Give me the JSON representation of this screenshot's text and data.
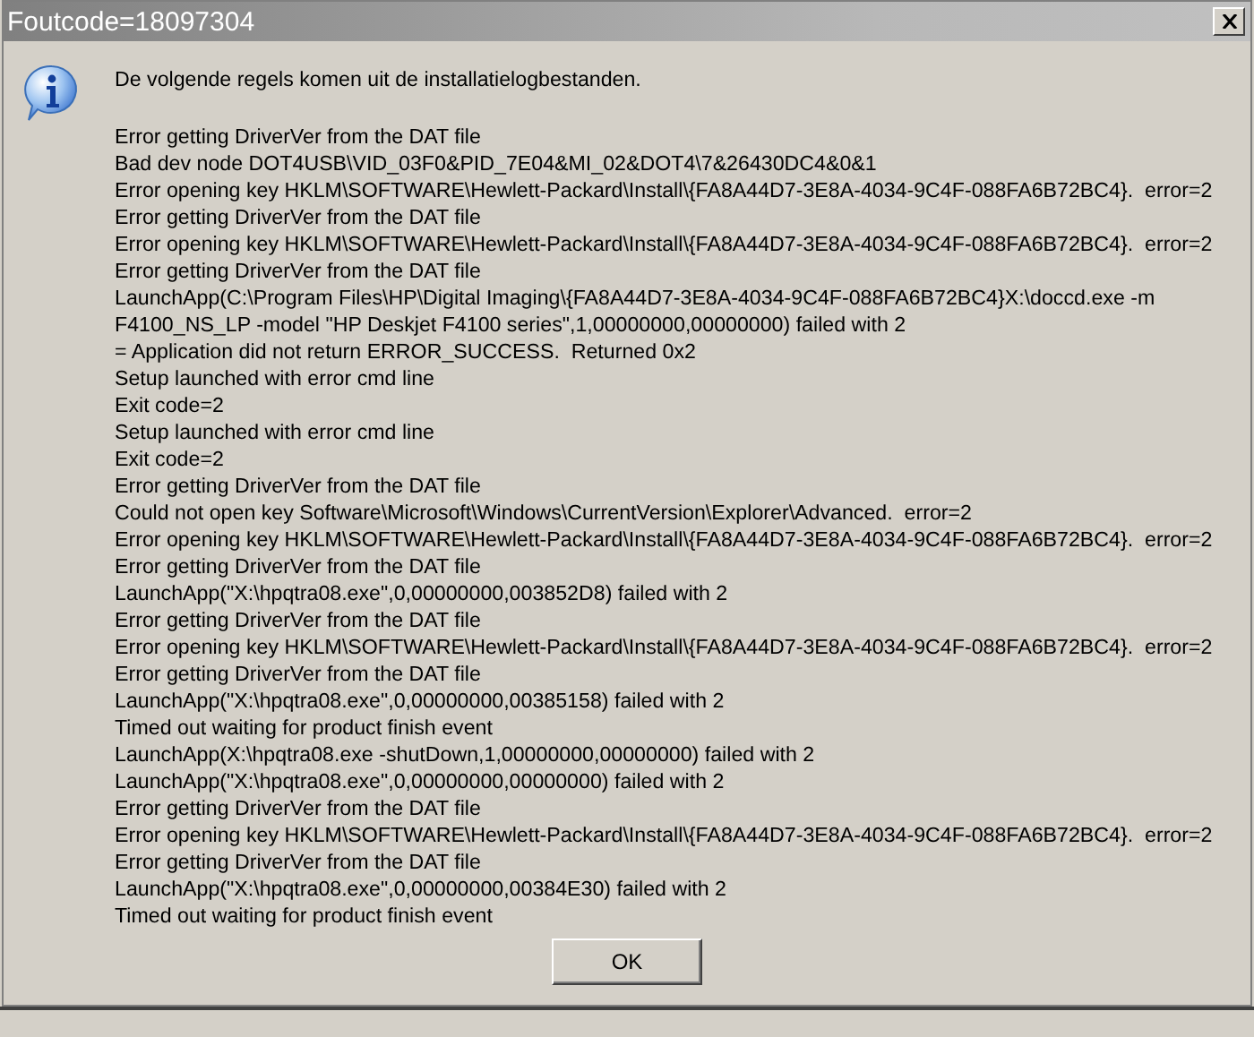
{
  "window": {
    "title": "Foutcode=18097304"
  },
  "intro": "De volgende regels komen uit de installatielogbestanden.",
  "log_lines": [
    "Error getting DriverVer from the DAT file",
    "Bad dev node DOT4USB\\VID_03F0&PID_7E04&MI_02&DOT4\\7&26430DC4&0&1",
    "Error opening key HKLM\\SOFTWARE\\Hewlett-Packard\\Install\\{FA8A44D7-3E8A-4034-9C4F-088FA6B72BC4}.  error=2",
    "Error getting DriverVer from the DAT file",
    "Error opening key HKLM\\SOFTWARE\\Hewlett-Packard\\Install\\{FA8A44D7-3E8A-4034-9C4F-088FA6B72BC4}.  error=2",
    "Error getting DriverVer from the DAT file",
    "LaunchApp(C:\\Program Files\\HP\\Digital Imaging\\{FA8A44D7-3E8A-4034-9C4F-088FA6B72BC4}X:\\doccd.exe -m",
    "F4100_NS_LP -model \"HP Deskjet F4100 series\",1,00000000,00000000) failed with 2",
    "= Application did not return ERROR_SUCCESS.  Returned 0x2",
    "Setup launched with error cmd line",
    "Exit code=2",
    "Setup launched with error cmd line",
    "Exit code=2",
    "Error getting DriverVer from the DAT file",
    "Could not open key Software\\Microsoft\\Windows\\CurrentVersion\\Explorer\\Advanced.  error=2",
    "Error opening key HKLM\\SOFTWARE\\Hewlett-Packard\\Install\\{FA8A44D7-3E8A-4034-9C4F-088FA6B72BC4}.  error=2",
    "Error getting DriverVer from the DAT file",
    "LaunchApp(\"X:\\hpqtra08.exe\",0,00000000,003852D8) failed with 2",
    "Error getting DriverVer from the DAT file",
    "Error opening key HKLM\\SOFTWARE\\Hewlett-Packard\\Install\\{FA8A44D7-3E8A-4034-9C4F-088FA6B72BC4}.  error=2",
    "Error getting DriverVer from the DAT file",
    "LaunchApp(\"X:\\hpqtra08.exe\",0,00000000,00385158) failed with 2",
    "Timed out waiting for product finish event",
    "LaunchApp(X:\\hpqtra08.exe -shutDown,1,00000000,00000000) failed with 2",
    "LaunchApp(\"X:\\hpqtra08.exe\",0,00000000,00000000) failed with 2",
    "Error getting DriverVer from the DAT file",
    "Error opening key HKLM\\SOFTWARE\\Hewlett-Packard\\Install\\{FA8A44D7-3E8A-4034-9C4F-088FA6B72BC4}.  error=2",
    "Error getting DriverVer from the DAT file",
    "LaunchApp(\"X:\\hpqtra08.exe\",0,00000000,00384E30) failed with 2",
    "Timed out waiting for product finish event"
  ],
  "buttons": [
    "OK"
  ]
}
